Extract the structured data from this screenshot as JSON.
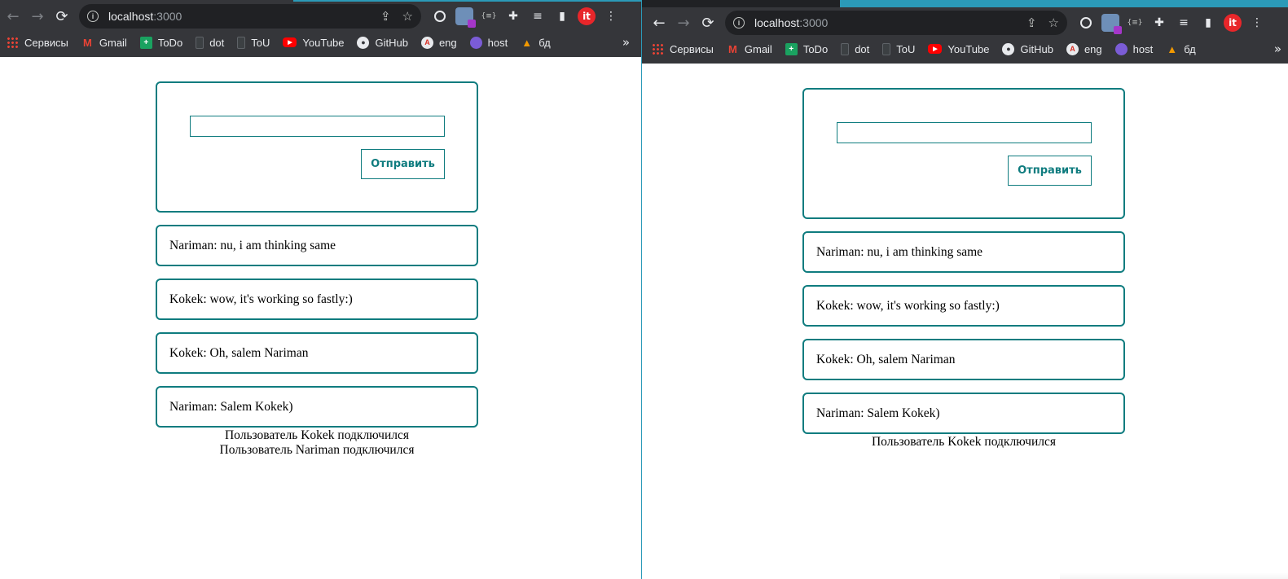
{
  "browser": {
    "url_host": "localhost",
    "url_port": ":3000",
    "bookmarks": [
      "Сервисы",
      "Gmail",
      "ToDo",
      "dot",
      "ToU",
      "YouTube",
      "GitHub",
      "eng",
      "host",
      "бд"
    ],
    "more": "»"
  },
  "left_window": {
    "send_label": "Отправить",
    "input_value": "",
    "messages": [
      "Nariman: nu, i am thinking same",
      "Kokek: wow, it's working so fastly:)",
      "Kokek: Oh, salem Nariman",
      "Nariman: Salem Kokek)"
    ],
    "status": [
      "Пользователь Kokek подключился",
      "Пользователь Nariman подключился"
    ]
  },
  "right_window": {
    "send_label": "Отправить",
    "input_value": "",
    "messages": [
      "Nariman: nu, i am thinking same",
      "Kokek: wow, it's working so fastly:)",
      "Kokek: Oh, salem Nariman",
      "Nariman: Salem Kokek)"
    ],
    "status": [
      "Пользователь Kokek подключился"
    ]
  },
  "colors": {
    "accent": "#0f7c7f",
    "chrome_bg": "#35363a",
    "omnibox_bg": "#202124",
    "window_divider": "#2b9ab8"
  }
}
